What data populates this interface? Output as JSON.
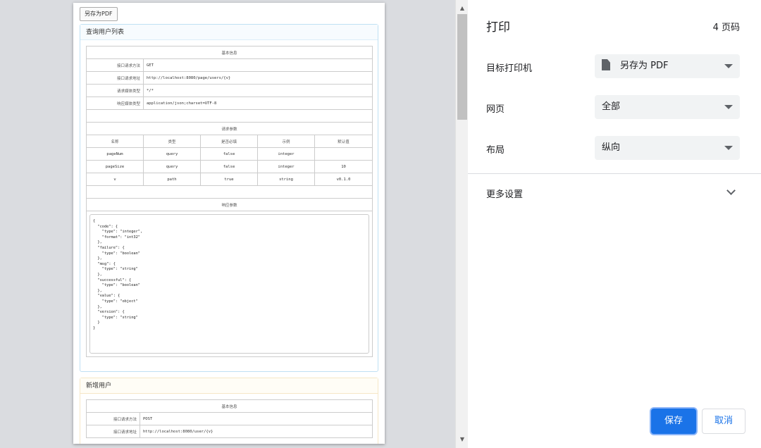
{
  "preview": {
    "pdf_button": "另存为PDF",
    "sections": [
      {
        "title": "查询用户列表",
        "basic_info_header": "基本信息",
        "basic_info": [
          {
            "label": "接口请求方法",
            "value": "GET"
          },
          {
            "label": "接口请求地址",
            "value": "http://localhost:8080/page/users/{v}"
          },
          {
            "label": "请求媒体类型",
            "value": "*/*"
          },
          {
            "label": "响应媒体类型",
            "value": "application/json;charset=UTF-8"
          }
        ],
        "params_header": "请求参数",
        "params_columns": [
          "名称",
          "类型",
          "是否必填",
          "示例",
          "默认值"
        ],
        "params_rows": [
          [
            "pageNum",
            "query",
            "false",
            "integer",
            ""
          ],
          [
            "pageSize",
            "query",
            "false",
            "integer",
            "10"
          ],
          [
            "v",
            "path",
            "true",
            "string",
            "v0.1.0"
          ]
        ],
        "response_header": "响应参数",
        "response_json": "{\n  \"code\": {\n    \"type\": \"integer\",\n    \"format\": \"int32\"\n  },\n  \"failure\": {\n    \"type\": \"boolean\"\n  },\n  \"msg\": {\n    \"type\": \"string\"\n  },\n  \"successful\": {\n    \"type\": \"boolean\"\n  },\n  \"value\": {\n    \"type\": \"object\"\n  },\n  \"version\": {\n    \"type\": \"string\"\n  }\n}"
      },
      {
        "title": "新增用户",
        "basic_info_header": "基本信息",
        "basic_info": [
          {
            "label": "接口请求方法",
            "value": "POST"
          },
          {
            "label": "接口请求地址",
            "value": "http://localhost:8080/user/{v}"
          }
        ]
      }
    ]
  },
  "print": {
    "title": "打印",
    "page_count": "4 页码",
    "destination_label": "目标打印机",
    "destination_value": "另存为 PDF",
    "pages_label": "网页",
    "pages_value": "全部",
    "layout_label": "布局",
    "layout_value": "纵向",
    "more_settings": "更多设置",
    "save_button": "保存",
    "cancel_button": "取消"
  },
  "colors": {
    "accent": "#1a73e8",
    "select_bg": "#f1f3f4"
  }
}
